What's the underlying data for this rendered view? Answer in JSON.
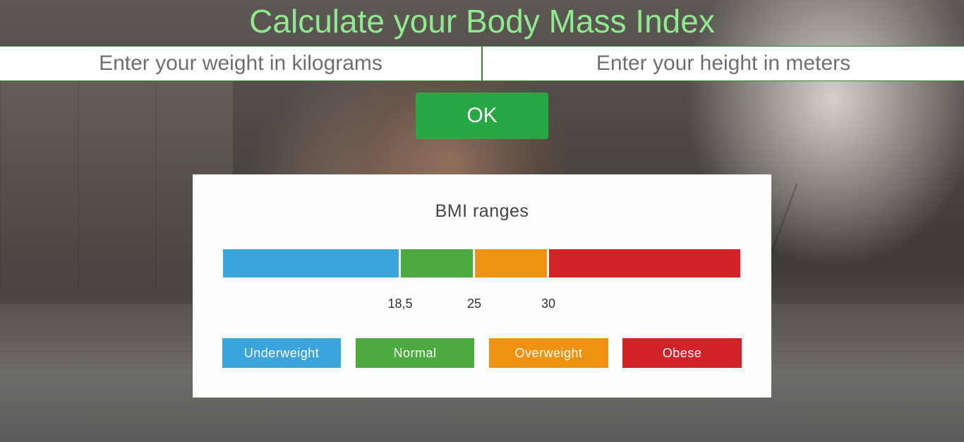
{
  "header": {
    "title": "Calculate your Body Mass Index"
  },
  "form": {
    "weight_placeholder": "Enter your weight in kilograms",
    "height_placeholder": "Enter your height in meters",
    "ok_label": "OK"
  },
  "colors": {
    "title": "#8fea8f",
    "ok_button": "#28a745",
    "underweight": "#3aa4dc",
    "normal": "#4cab3e",
    "overweight": "#ef920f",
    "obese": "#d12228"
  },
  "bmi_card": {
    "title": "BMI ranges",
    "thresholds": [
      "18,5",
      "25",
      "30"
    ],
    "categories": [
      {
        "label": "Underweight",
        "color": "#3aa4dc"
      },
      {
        "label": "Normal",
        "color": "#4cab3e"
      },
      {
        "label": "Overweight",
        "color": "#ef920f"
      },
      {
        "label": "Obese",
        "color": "#d12228"
      }
    ]
  }
}
